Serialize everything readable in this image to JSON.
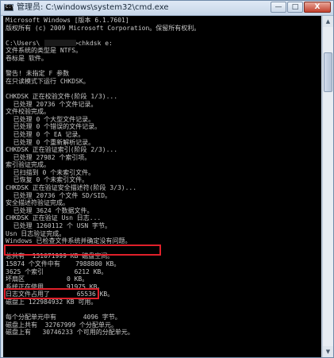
{
  "window": {
    "title": "管理员: C:\\windows\\system32\\cmd.exe",
    "app_icon_glyph": "C:\\",
    "buttons": {
      "minimize": "—",
      "maximize": "□",
      "close": "X"
    }
  },
  "console": {
    "lines": [
      "Microsoft Windows [版本 6.1.7601]",
      "版权所有 (c) 2009 Microsoft Corporation。保留所有权利。",
      "",
      "C:\\Users\\         >chkdsk e:",
      "文件系统的类型是 NTFS。",
      "卷标是 软件。",
      "",
      "警告! 未指定 F 参数",
      "在只读模式下运行 CHKDSK。",
      "",
      "CHKDSK 正在校验文件(阶段 1/3)...",
      "  已处理 20736 个文件记录。",
      "文件校验完成。",
      "  已处理 0 个大型文件记录。",
      "  已处理 0 个错误的文件记录。",
      "  已处理 0 个 EA 记录。",
      "  已处理 0 个重新解析记录。",
      "CHKDSK 正在验证索引(阶段 2/3)...",
      "  已处理 27982 个索引项。",
      "索引验证完成。",
      "  已扫描到 0 个未索引文件。",
      "  已恢复 0 个未索引文件。",
      "CHKDSK 正在验证安全描述符(阶段 3/3)...",
      "  已处理 20736 个文件 SD/SID。",
      "安全描述符验证完成。",
      "  已处理 3624 个数据文件。",
      "CHKDSK 正在验证 Usn 日志...",
      "  已处理 1260112 个 USN 字节。",
      "Usn 日志验证完成。",
      "Windows 已检查文件系统并确定没有问题。",
      "",
      "总共有  131071999 KB 磁盘空间。",
      "15874 个文件中有    7988800 KB。",
      "3625 个索引        6212 KB。",
      "坏扇区           0 KB。",
      "系统正在使用      91975 KB。",
      "日志文件占用了       65536 KB。",
      "磁盘上 122984932 KB 可用。",
      "",
      "每个分配单元中有       4096 字节。",
      "磁盘上共有  32767999 个分配单元。",
      "磁盘上有   30746233 个可用的分配单元。"
    ]
  },
  "colors": {
    "console_bg": "#000000",
    "console_text": "#c8c8c8",
    "highlight": "#e0202a",
    "close_button": "#c2412e"
  }
}
